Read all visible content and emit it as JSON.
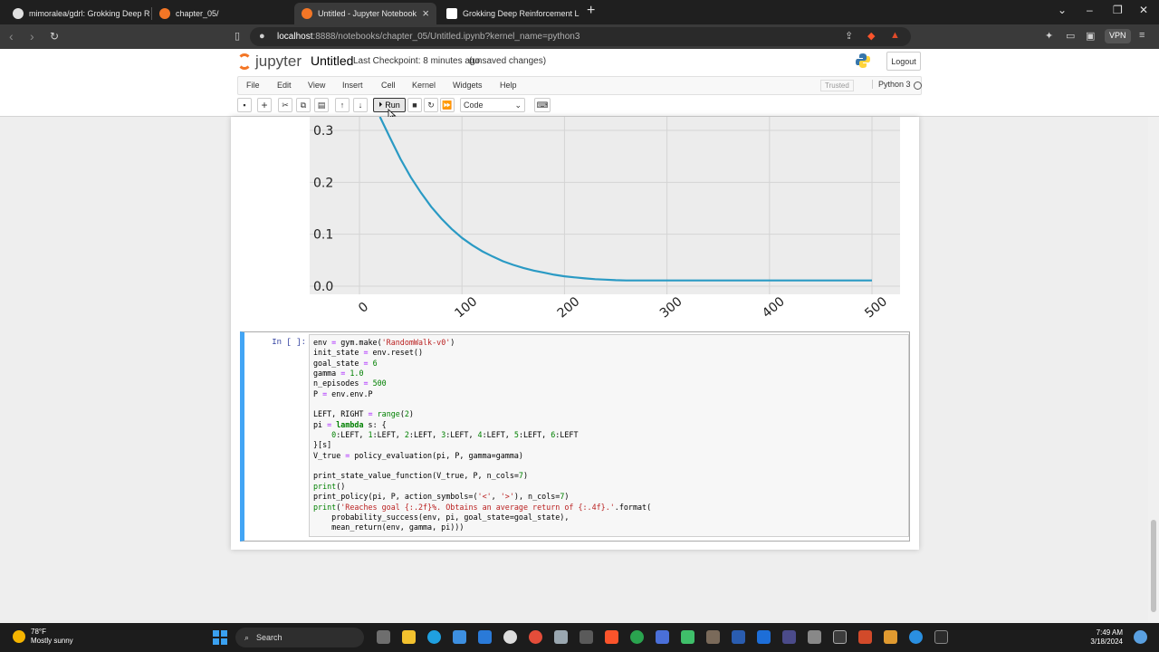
{
  "browser": {
    "tabs": [
      {
        "label": "mimoralea/gdrl: Grokking Deep Rein",
        "active": false
      },
      {
        "label": "chapter_05/",
        "active": false
      },
      {
        "label": "Untitled - Jupyter Notebook",
        "active": true
      },
      {
        "label": "Grokking Deep Reinforcement Learn",
        "active": false
      }
    ],
    "url_host": "localhost",
    "url_path": ":8888/notebooks/chapter_05/Untitled.ipynb?kernel_name=python3",
    "vpn_label": "VPN"
  },
  "jupyter": {
    "logo_text": "jupyter",
    "title": "Untitled",
    "checkpoint": "Last Checkpoint: 8 minutes ago",
    "unsaved": "(unsaved changes)",
    "logout": "Logout",
    "menu": [
      "File",
      "Edit",
      "View",
      "Insert",
      "Cell",
      "Kernel",
      "Widgets",
      "Help"
    ],
    "trusted": "Trusted",
    "kernel": "Python 3",
    "run_label": "Run",
    "cell_type": "Code"
  },
  "chart_data": {
    "type": "line",
    "x_ticks": [
      "0",
      "100",
      "200",
      "300",
      "400",
      "500"
    ],
    "y_ticks": [
      "0.0",
      "0.1",
      "0.2",
      "0.3"
    ],
    "xlim": [
      -40,
      520
    ],
    "ylim": [
      -0.02,
      0.34
    ],
    "grid": true,
    "color": "#2a9ac4",
    "series": [
      {
        "x": [
          20,
          30,
          40,
          50,
          60,
          70,
          80,
          90,
          100,
          110,
          120,
          130,
          140,
          150,
          160,
          170,
          180,
          190,
          200,
          210,
          220,
          230,
          240,
          250,
          260,
          280,
          300,
          350,
          400,
          450,
          500
        ],
        "values": [
          0.33,
          0.285,
          0.245,
          0.21,
          0.18,
          0.153,
          0.13,
          0.11,
          0.093,
          0.079,
          0.067,
          0.057,
          0.048,
          0.041,
          0.035,
          0.03,
          0.026,
          0.022,
          0.019,
          0.017,
          0.015,
          0.0135,
          0.0125,
          0.0115,
          0.011,
          0.011,
          0.011,
          0.011,
          0.011,
          0.011,
          0.011
        ]
      }
    ]
  },
  "cell": {
    "prompt": "In [ ]:",
    "code": [
      "env = gym.make('RandomWalk-v0')",
      "init_state = env.reset()",
      "goal_state = 6",
      "gamma = 1.0",
      "n_episodes = 500",
      "P = env.env.P",
      "",
      "LEFT, RIGHT = range(2)",
      "pi = lambda s: {",
      "    0:LEFT, 1:LEFT, 2:LEFT, 3:LEFT, 4:LEFT, 5:LEFT, 6:LEFT",
      "}[s]",
      "V_true = policy_evaluation(pi, P, gamma=gamma)",
      "",
      "print_state_value_function(V_true, P, n_cols=7)",
      "print()",
      "print_policy(pi, P, action_symbols=('<', '>'), n_cols=7)",
      "print('Reaches goal {:.2f}%. Obtains an average return of {:.4f}.'.format(",
      "    probability_success(env, pi, goal_state=goal_state),",
      "    mean_return(env, gamma, pi)))"
    ]
  },
  "taskbar": {
    "temperature": "78°F",
    "weather": "Mostly sunny",
    "search": "Search",
    "time": "7:49 AM",
    "date": "3/18/2024"
  }
}
